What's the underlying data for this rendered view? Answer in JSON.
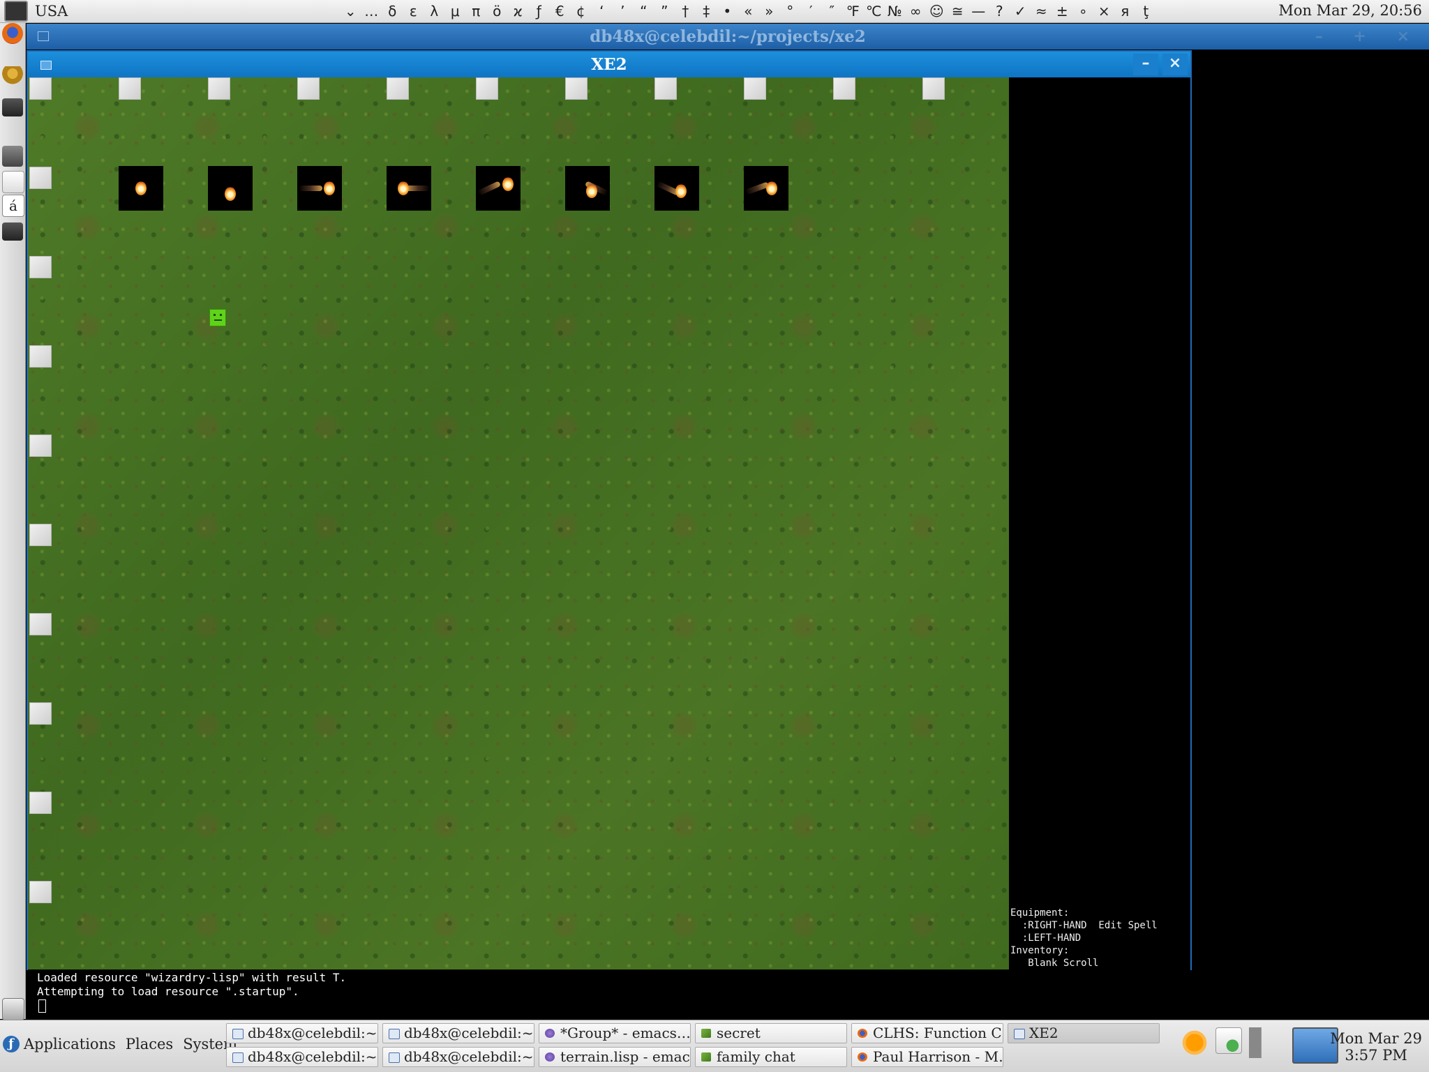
{
  "top_panel": {
    "layout": "USA",
    "chars": [
      "⌄",
      "…",
      "δ",
      "ε",
      "λ",
      "μ",
      "π",
      "ö",
      "ϰ",
      "ƒ",
      "€",
      "¢",
      "‘",
      "’",
      "“",
      "”",
      "†",
      "‡",
      "•",
      "«",
      "»",
      "°",
      "′",
      "″",
      "℉",
      "℃",
      "№",
      "∞",
      "☺",
      "≅",
      "—",
      "?",
      "✓",
      "≈",
      "±",
      "∘",
      "×",
      "я",
      "ţ"
    ],
    "clock": "Mon Mar 29, 20:56"
  },
  "terminal_window": {
    "title": "db48x@celebdil:~/projects/xe2",
    "buttons": "– + ×"
  },
  "xe2_window": {
    "title": "XE2",
    "min_label": "–",
    "close_label": "×"
  },
  "status": {
    "text": "Equipment:\n  :RIGHT-HAND  Edit Spell\n  :LEFT-HAND\nInventory:\n   Blank Scroll"
  },
  "terminal_output": {
    "lines": [
      "Loaded resource \"wizardry-lisp\" with result T.",
      "Attempting to load resource \".startup\"."
    ]
  },
  "bottom_panel": {
    "menus": [
      "Applications",
      "Places",
      "System"
    ],
    "tasks": [
      {
        "label": "db48x@celebdil:~…",
        "icon": "terminal-icon"
      },
      {
        "label": "db48x@celebdil:~…",
        "icon": "terminal-icon"
      },
      {
        "label": "*Group* - emacs…",
        "icon": "emacs-icon"
      },
      {
        "label": "secret",
        "icon": "chat-icon"
      },
      {
        "label": "CLHS: Function C…",
        "icon": "firefox-icon"
      },
      {
        "label": "XE2",
        "icon": "terminal-icon",
        "active": true
      },
      {
        "label": "db48x@celebdil:~",
        "icon": "terminal-icon"
      },
      {
        "label": "db48x@celebdil:~",
        "icon": "terminal-icon"
      },
      {
        "label": "terrain.lisp - emac…",
        "icon": "emacs-icon"
      },
      {
        "label": "family chat",
        "icon": "chat-icon"
      },
      {
        "label": "Paul Harrison - M…",
        "icon": "firefox-icon"
      }
    ],
    "clock_date": "Mon Mar 29",
    "clock_time": "3:57 PM"
  }
}
